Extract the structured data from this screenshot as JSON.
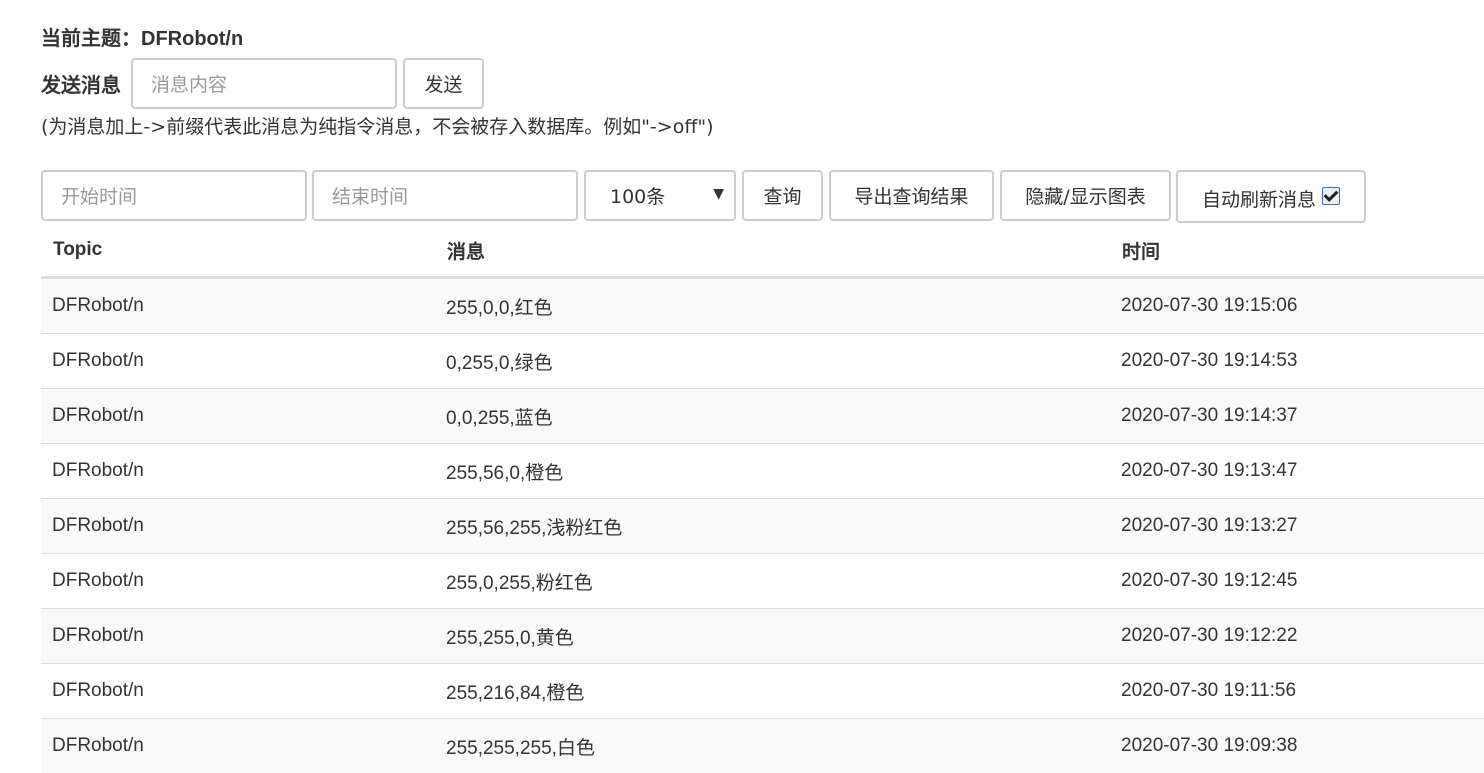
{
  "header": {
    "topic_label": "当前主题：",
    "topic_value": "DFRobot/n"
  },
  "send": {
    "label": "发送消息",
    "input_placeholder": "消息内容",
    "send_button": "发送",
    "hint": "(为消息加上->前缀代表此消息为纯指令消息，不会被存入数据库。例如\"->off\")"
  },
  "query": {
    "start_placeholder": "开始时间",
    "end_placeholder": "结束时间",
    "limit_selected": "100条",
    "query_button": "查询",
    "export_button": "导出查询结果",
    "toggle_chart_button": "隐藏/显示图表",
    "auto_refresh_label": "自动刷新消息",
    "auto_refresh_checked": true
  },
  "table": {
    "columns": [
      "Topic",
      "消息",
      "时间"
    ],
    "rows": [
      [
        "DFRobot/n",
        "255,0,0,红色",
        "2020-07-30 19:15:06"
      ],
      [
        "DFRobot/n",
        "0,255,0,绿色",
        "2020-07-30 19:14:53"
      ],
      [
        "DFRobot/n",
        "0,0,255,蓝色",
        "2020-07-30 19:14:37"
      ],
      [
        "DFRobot/n",
        "255,56,0,橙色",
        "2020-07-30 19:13:47"
      ],
      [
        "DFRobot/n",
        "255,56,255,浅粉红色",
        "2020-07-30 19:13:27"
      ],
      [
        "DFRobot/n",
        "255,0,255,粉红色",
        "2020-07-30 19:12:45"
      ],
      [
        "DFRobot/n",
        "255,255,0,黄色",
        "2020-07-30 19:12:22"
      ],
      [
        "DFRobot/n",
        "255,216,84,橙色",
        "2020-07-30 19:11:56"
      ],
      [
        "DFRobot/n",
        "255,255,255,白色",
        "2020-07-30 19:09:38"
      ]
    ]
  }
}
